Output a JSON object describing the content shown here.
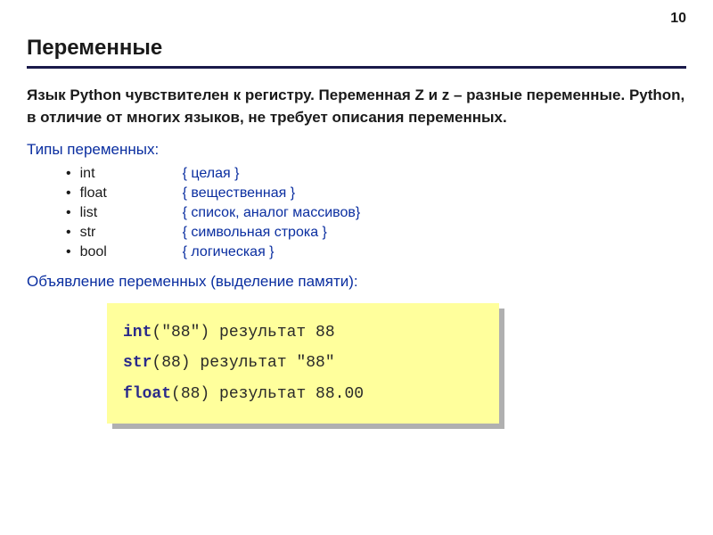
{
  "page_number": "10",
  "title": "Переменные",
  "intro": "Язык Python чувствителен к регистру. Переменная Z и z – разные переменные. Python, в отличие от многих языков, не требует описания переменных.",
  "types_header": "Типы переменных:",
  "types": [
    {
      "name": "int",
      "desc": "{ целая }"
    },
    {
      "name": "float",
      "desc": "{ вещественная }"
    },
    {
      "name": "list",
      "desc": "{ список, аналог массивов}"
    },
    {
      "name": "str",
      "desc": "{ символьная строка }"
    },
    {
      "name": "bool",
      "desc": "{ логическая }"
    }
  ],
  "decl_header": "Объявление переменных (выделение памяти):",
  "code": {
    "l1_func": "int",
    "l1_arg": "(\"88\")",
    "l1_res": " результат 88",
    "l2_func": "str",
    "l2_arg": "(88)",
    "l2_res": " результат \"88\"",
    "l3_func": "float",
    "l3_arg": "(88)",
    "l3_res": " результат 88.00"
  }
}
